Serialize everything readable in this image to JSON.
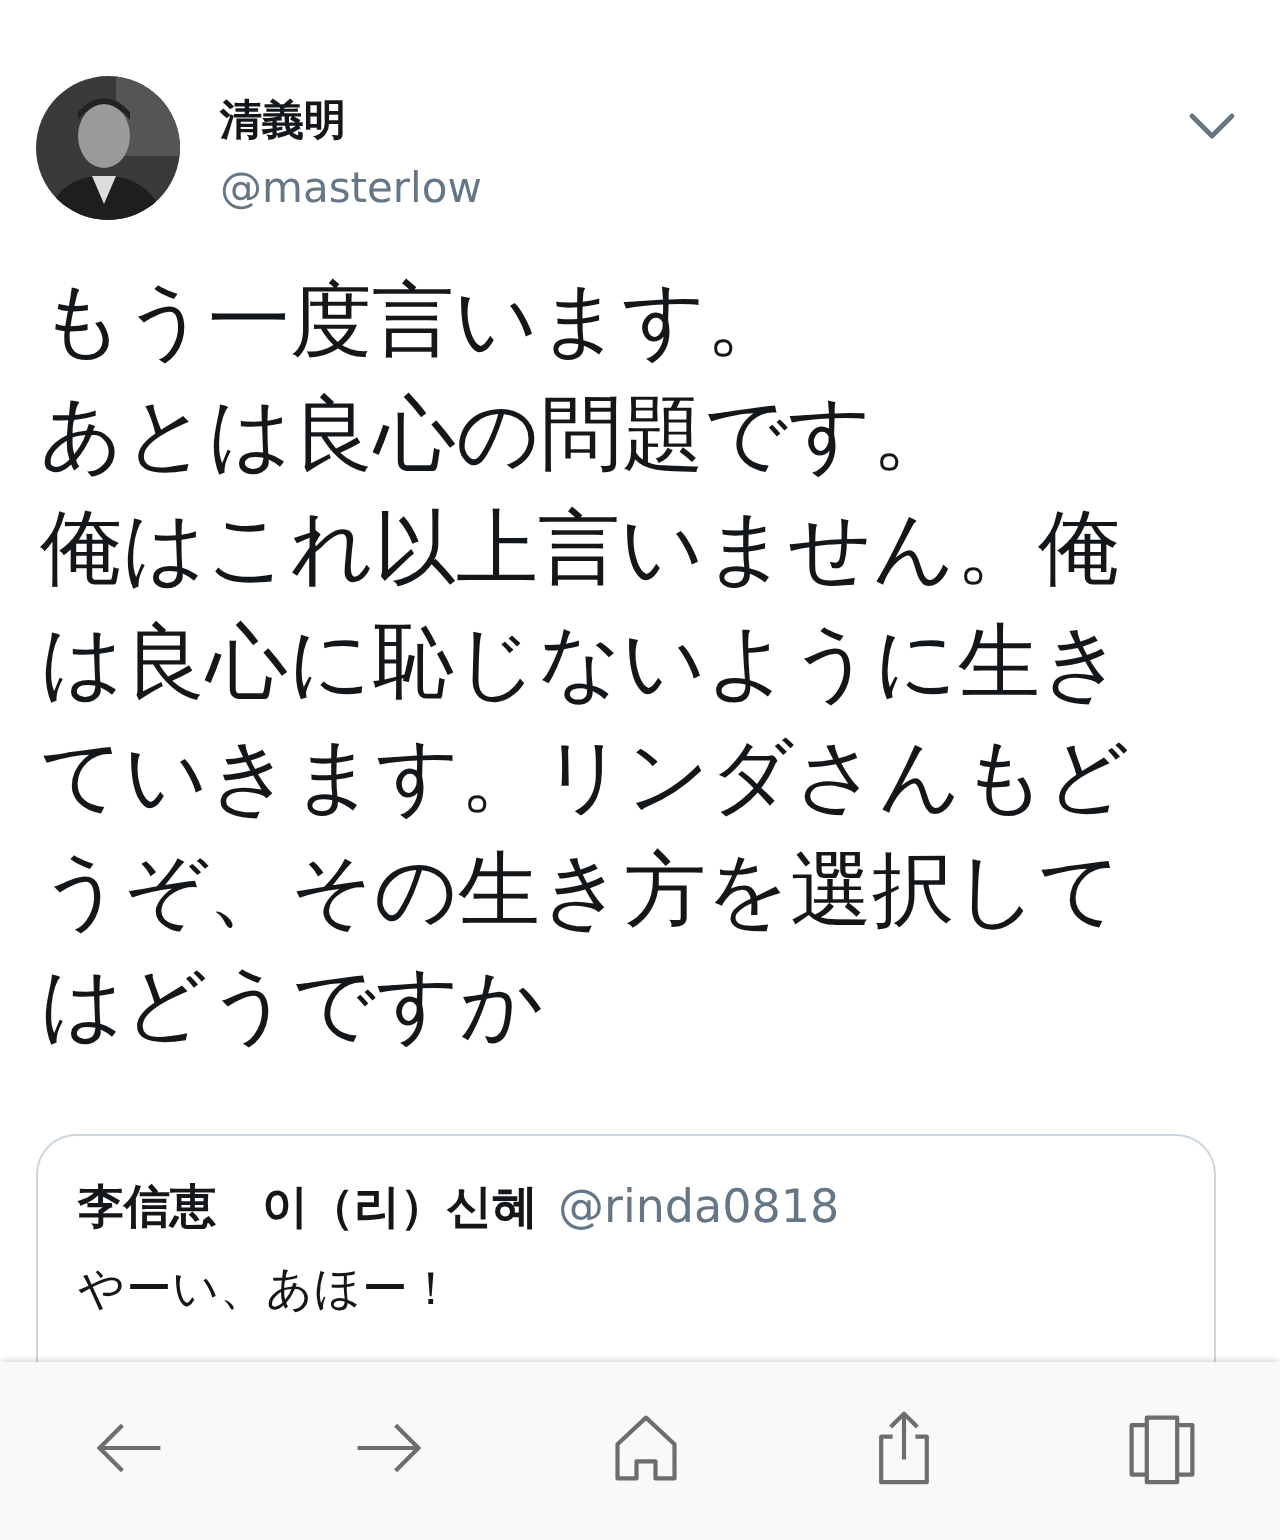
{
  "tweet": {
    "author_name": "清義明",
    "handle": "@masterlow",
    "paragraphs": [
      "もう一度言います。",
      "あとは良心の問題です。",
      "俺はこれ以上言いません。俺は良心に恥じないように生きていきます。リンダさんもどうぞ、その生き方を選択してはどうですか"
    ]
  },
  "quoted_tweet": {
    "author_name": "李信恵　이（리）신혜",
    "handle": "@rinda0818",
    "text": "やーい、あほー！"
  },
  "toolbar": [
    {
      "kind": "back"
    },
    {
      "kind": "forward"
    },
    {
      "kind": "home"
    },
    {
      "kind": "share"
    },
    {
      "kind": "tabs"
    }
  ]
}
